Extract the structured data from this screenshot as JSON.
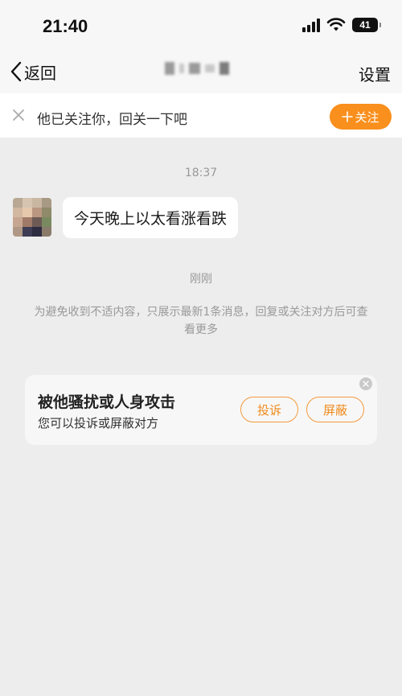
{
  "status_bar": {
    "time": "21:40",
    "battery": "41"
  },
  "nav": {
    "back_label": "返回",
    "settings_label": "设置"
  },
  "follow_bar": {
    "message": "他已关注你，回关一下吧",
    "follow_label": "关注",
    "accent_color": "#f98f1c"
  },
  "chat": {
    "messages": [
      {
        "time": "18:37",
        "text": "今天晚上以太看涨看跌"
      }
    ],
    "recent_time": "刚刚",
    "notice": "为避免收到不适内容，只展示最新1条消息，回复或关注对方后可查看更多"
  },
  "harassment_card": {
    "title": "被他骚扰或人身攻击",
    "subtitle": "您可以投诉或屏蔽对方",
    "report_label": "投诉",
    "block_label": "屏蔽"
  }
}
